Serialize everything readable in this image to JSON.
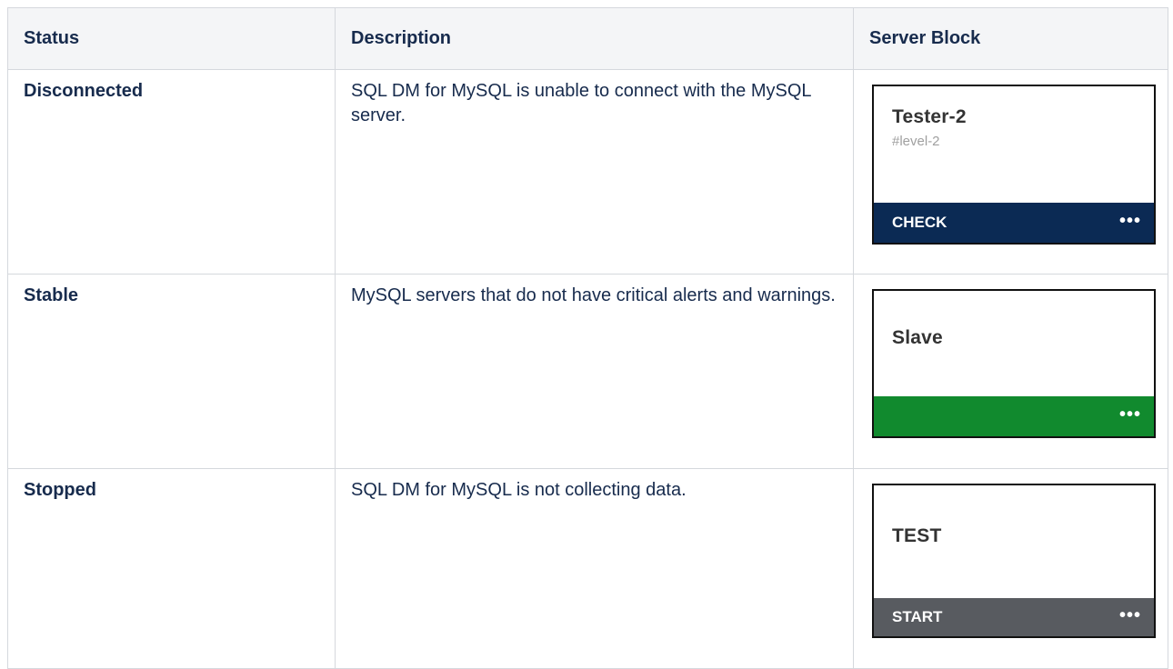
{
  "table": {
    "headers": {
      "status": "Status",
      "description": "Description",
      "server_block": "Server Block"
    },
    "rows": [
      {
        "status": "Disconnected",
        "description": "SQL DM for MySQL is unable to connect with the MySQL server.",
        "block": {
          "name": "Tester-2",
          "subtitle": "#level-2",
          "action": "CHECK",
          "menu": "•••",
          "bar_color": "#0b2a54"
        }
      },
      {
        "status": "Stable",
        "description": "MySQL servers that do not have critical alerts and warnings.",
        "block": {
          "name": "Slave",
          "subtitle": "",
          "action": "",
          "menu": "•••",
          "bar_color": "#118a2e"
        }
      },
      {
        "status": "Stopped",
        "description": "SQL DM for MySQL is not collecting data.",
        "block": {
          "name": "TEST",
          "subtitle": "",
          "action": "START",
          "menu": "•••",
          "bar_color": "#585b60"
        }
      }
    ]
  }
}
